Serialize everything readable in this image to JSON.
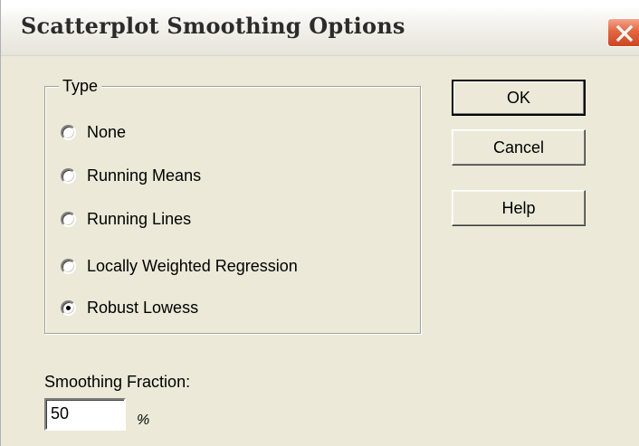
{
  "window": {
    "title": "Scatterplot Smoothing Options",
    "close_icon": "close-icon"
  },
  "type_group": {
    "label": "Type",
    "options": [
      {
        "label": "None",
        "selected": false
      },
      {
        "label": "Running Means",
        "selected": false
      },
      {
        "label": "Running Lines",
        "selected": false
      },
      {
        "label": "Locally Weighted Regression",
        "selected": false
      },
      {
        "label": "Robust Lowess",
        "selected": true
      }
    ]
  },
  "buttons": {
    "ok": "OK",
    "cancel": "Cancel",
    "help": "Help"
  },
  "smoothing": {
    "label": "Smoothing Fraction:",
    "value": "50",
    "unit": "%"
  },
  "colors": {
    "dialog_bg": "#ece9d8",
    "close_button": "#e4663f"
  }
}
